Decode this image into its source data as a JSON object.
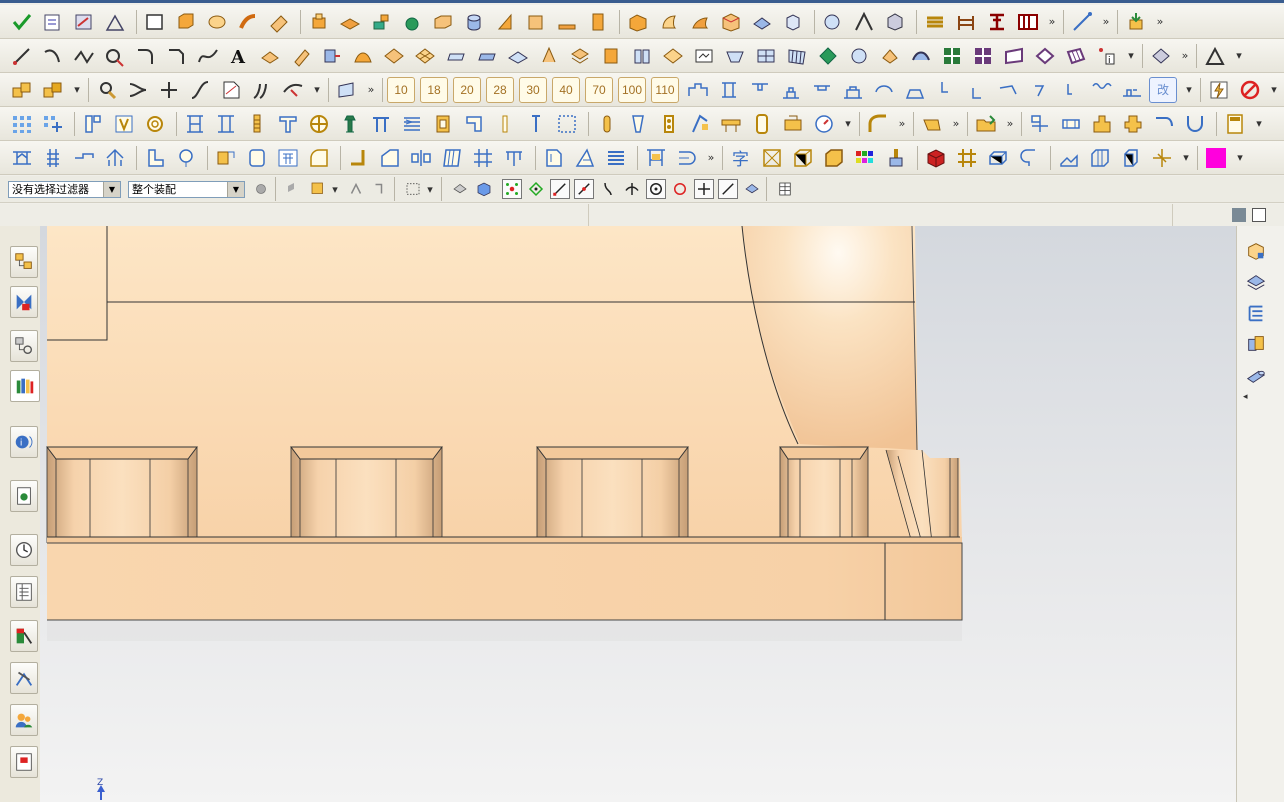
{
  "filter_bar": {
    "selection_filter": "没有选择过滤器",
    "scope": "整个装配"
  },
  "toolbar_row3_numbers": [
    "10",
    "18",
    "20",
    "28",
    "30",
    "40",
    "70",
    "100",
    "110"
  ],
  "toolbar_row3_badge": "改",
  "colors": {
    "part_fill": "#f8d2a8",
    "part_highlight": "#fde6c6",
    "viewport_bg_top": "#d8dbe0",
    "viewport_bg_bottom": "#f2f2f2",
    "accent_magenta": "#ff00dd"
  },
  "axis_triad_label": "Z"
}
